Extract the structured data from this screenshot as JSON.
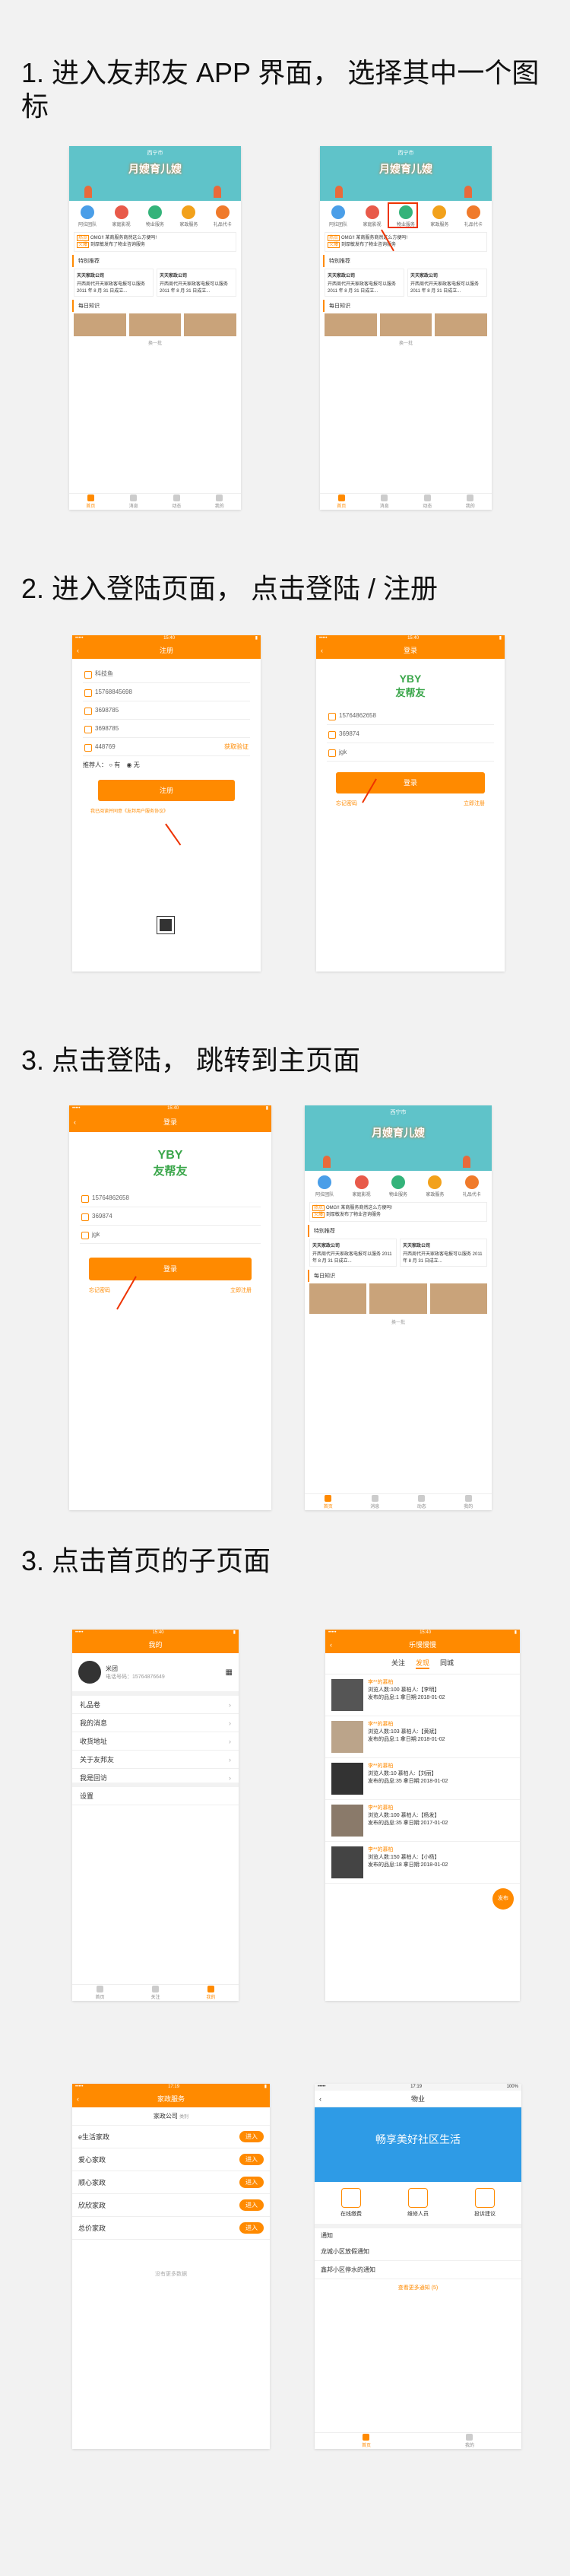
{
  "steps": [
    {
      "title": "1. 进入友邦友 APP 界面，   选择其中一个图标"
    },
    {
      "title": "2. 进入登陆页面，   点击登陆 / 注册"
    },
    {
      "title": "3. 点击登陆，   跳转到主页面"
    },
    {
      "title": "3. 点击首页的子页面"
    }
  ],
  "home": {
    "location": "西宁市",
    "banner": "月嫂育儿嫂",
    "icons": [
      "阿拉团队",
      "家庭影视",
      "物业服务",
      "家政服务",
      "礼品代卡"
    ],
    "news_tag1": "热点",
    "news1": "OMG!! 某商服务商然这么方便吗!",
    "news_tag2": "火爆",
    "news2": "到厚敏发布了物业咨询服务",
    "section1": "特别推荐",
    "company1": "天天家政公司",
    "company2": "天天家政公司",
    "company_desc": "开西周代开天家政客电报可以服务 2011 年 8 月 31 日成立...",
    "section2": "每日知识",
    "more": "换一批",
    "tabs": [
      "首页",
      "消息",
      "动态",
      "我的"
    ]
  },
  "register": {
    "title": "注册",
    "fields": [
      "科技鱼",
      "15768845698",
      "3698785",
      "3698785",
      "448769"
    ],
    "get_code": "获取验证",
    "referrer": "推荐人：",
    "yes": "有",
    "no": "无",
    "btn": "注册",
    "agree": "我已阅读并同意《友邦用户服务协议》"
  },
  "login": {
    "title": "登录",
    "logo_top": "YBY",
    "logo": "友帮友",
    "phone": "15764862658",
    "pwd": "369874",
    "code": "jgk",
    "btn": "登录",
    "left_link": "忘记密码",
    "right_link": "立即注册"
  },
  "mine": {
    "title": "我的",
    "name": "米团",
    "phone": "电话号码：15764876649",
    "items": [
      "礼品卷",
      "我的消息",
      "收货地址",
      "关于友邦友",
      "我是回访"
    ],
    "settings": "设置",
    "tabs": [
      "首页",
      "关注",
      "我的"
    ]
  },
  "feed": {
    "title": "乐慢慢慢",
    "tabs": [
      "关注",
      "发现",
      "同城"
    ],
    "author": "李**的慕柏",
    "rows": [
      {
        "info": "浏览人数:100   慕柏人:【李明】",
        "date": "发布的品息:1  拿日期:2018-01-02"
      },
      {
        "info": "浏览人数:103   慕柏人:【黄斌】",
        "date": "发布的品息:1  拿日期:2018-01-02"
      },
      {
        "info": "浏览人数:10    慕柏人:【刘丽】",
        "date": "发布的品息:35  拿日期:2018-01-02"
      },
      {
        "info": "浏览人数:100   慕柏人:【杨发】",
        "date": "发布的品息:35  拿日期:2017-01-02"
      },
      {
        "info": "浏览人数:150   慕柏人:【小杨】",
        "date": "发布的品息:18  拿日期:2018-01-02"
      }
    ],
    "fab": "发布"
  },
  "housekeeping": {
    "title": "家政服务",
    "filter": "家政公司",
    "filter_sub": "类别",
    "rows": [
      "e生活家政",
      "爱心家政",
      "顺心家政",
      "欣欣家政",
      "总价家政"
    ],
    "enter": "进入",
    "empty": "没有更多数据"
  },
  "property": {
    "title": "物业",
    "banner": "畅享美好社区生活",
    "actions": [
      "在线缴费",
      "维修人员",
      "投诉建议"
    ],
    "notice": "通知",
    "n1": "龙城小区放假通知",
    "n2": "鑫邦小区停水的通知",
    "more": "查看更多通知 (5)",
    "tabs": [
      "首页",
      "我的"
    ]
  },
  "colors": {
    "accent": "#ff8a00",
    "arrow": "#e53010",
    "banner": "#5fc3c9",
    "green": "#3aa64a"
  }
}
